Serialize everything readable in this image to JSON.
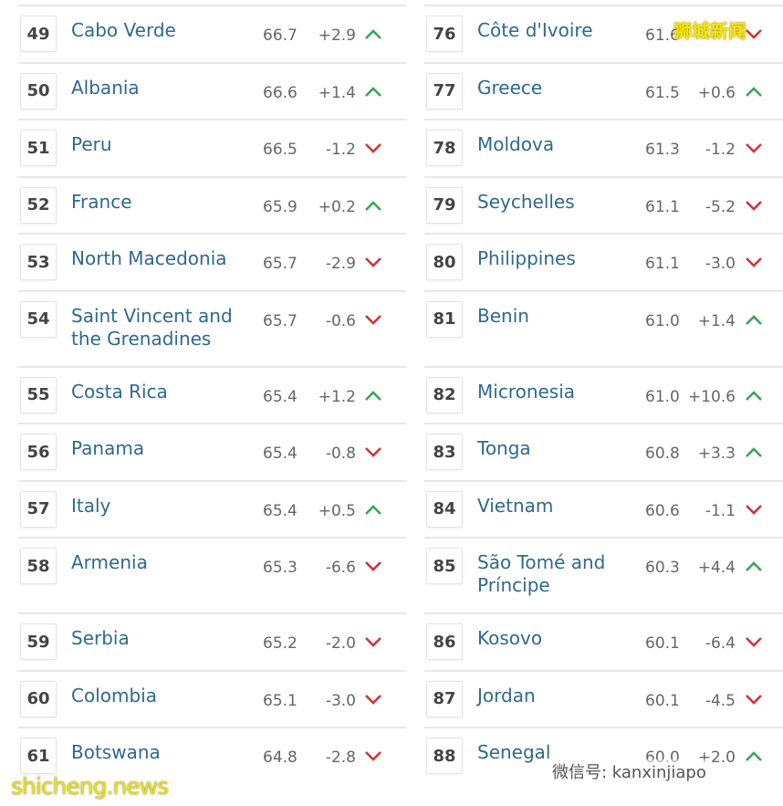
{
  "colors": {
    "up": "#3aa655",
    "down": "#d0343a",
    "name": "#2e6a8c"
  },
  "left": [
    {
      "rank": "49",
      "name": "Cabo Verde",
      "score": "66.7",
      "change": "+2.9",
      "dir": "up"
    },
    {
      "rank": "50",
      "name": "Albania",
      "score": "66.6",
      "change": "+1.4",
      "dir": "up"
    },
    {
      "rank": "51",
      "name": "Peru",
      "score": "66.5",
      "change": "-1.2",
      "dir": "down"
    },
    {
      "rank": "52",
      "name": "France",
      "score": "65.9",
      "change": "+0.2",
      "dir": "up"
    },
    {
      "rank": "53",
      "name": "North Macedonia",
      "score": "65.7",
      "change": "-2.9",
      "dir": "down"
    },
    {
      "rank": "54",
      "name": "Saint Vincent and the Grenadines",
      "score": "65.7",
      "change": "-0.6",
      "dir": "down"
    },
    {
      "rank": "55",
      "name": "Costa Rica",
      "score": "65.4",
      "change": "+1.2",
      "dir": "up"
    },
    {
      "rank": "56",
      "name": "Panama",
      "score": "65.4",
      "change": "-0.8",
      "dir": "down"
    },
    {
      "rank": "57",
      "name": "Italy",
      "score": "65.4",
      "change": "+0.5",
      "dir": "up"
    },
    {
      "rank": "58",
      "name": "Armenia",
      "score": "65.3",
      "change": "-6.6",
      "dir": "down"
    },
    {
      "rank": "59",
      "name": "Serbia",
      "score": "65.2",
      "change": "-2.0",
      "dir": "down"
    },
    {
      "rank": "60",
      "name": "Colombia",
      "score": "65.1",
      "change": "-3.0",
      "dir": "down"
    },
    {
      "rank": "61",
      "name": "Botswana",
      "score": "64.8",
      "change": "-2.8",
      "dir": "down"
    }
  ],
  "right": [
    {
      "rank": "76",
      "name": "Côte d'Ivoire",
      "score": "61.6",
      "change": "",
      "dir": "down"
    },
    {
      "rank": "77",
      "name": "Greece",
      "score": "61.5",
      "change": "+0.6",
      "dir": "up"
    },
    {
      "rank": "78",
      "name": "Moldova",
      "score": "61.3",
      "change": "-1.2",
      "dir": "down"
    },
    {
      "rank": "79",
      "name": "Seychelles",
      "score": "61.1",
      "change": "-5.2",
      "dir": "down"
    },
    {
      "rank": "80",
      "name": "Philippines",
      "score": "61.1",
      "change": "-3.0",
      "dir": "down"
    },
    {
      "rank": "81",
      "name": "Benin",
      "score": "61.0",
      "change": "+1.4",
      "dir": "up"
    },
    {
      "rank": "82",
      "name": "Micronesia",
      "score": "61.0",
      "change": "+10.6",
      "dir": "up"
    },
    {
      "rank": "83",
      "name": "Tonga",
      "score": "60.8",
      "change": "+3.3",
      "dir": "up"
    },
    {
      "rank": "84",
      "name": "Vietnam",
      "score": "60.6",
      "change": "-1.1",
      "dir": "down"
    },
    {
      "rank": "85",
      "name": "São Tomé and Príncipe",
      "score": "60.3",
      "change": "+4.4",
      "dir": "up"
    },
    {
      "rank": "86",
      "name": "Kosovo",
      "score": "60.1",
      "change": "-6.4",
      "dir": "down"
    },
    {
      "rank": "87",
      "name": "Jordan",
      "score": "60.1",
      "change": "-4.5",
      "dir": "down"
    },
    {
      "rank": "88",
      "name": "Senegal",
      "score": "60.0",
      "change": "+2.0",
      "dir": "up"
    }
  ],
  "watermarks": {
    "top_right": "狮城新闻",
    "bottom_left": "shicheng.news",
    "bottom_right": "微信号: kanxinjiapo"
  }
}
